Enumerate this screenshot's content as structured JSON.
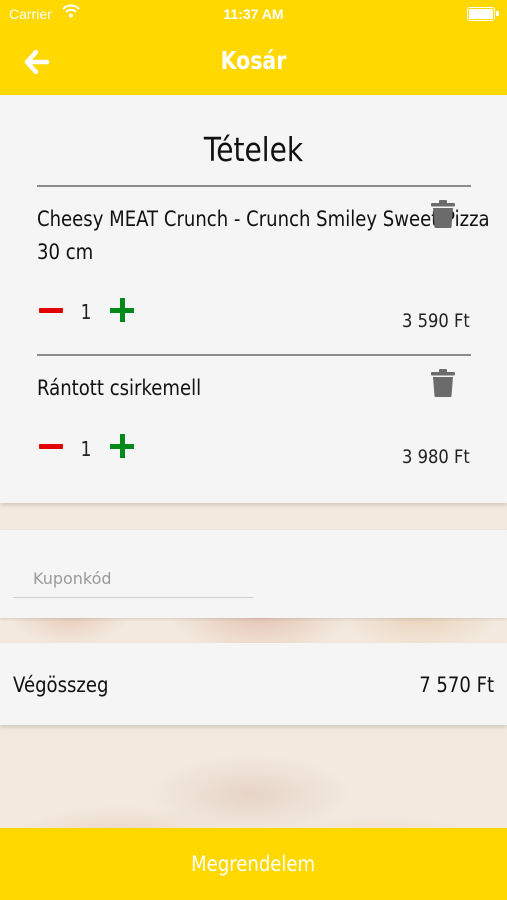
{
  "status_bar": {
    "carrier": "Carrier",
    "time": "11:37 AM"
  },
  "nav": {
    "title": "Kosár",
    "back_icon": "arrow-left-icon"
  },
  "cart": {
    "heading": "Tételek",
    "items": [
      {
        "name_line1": "Cheesy MEAT Crunch - Crunch Smiley Sweet Pizza",
        "name_line2": "30 cm",
        "quantity": "1",
        "price": "3 590 Ft"
      },
      {
        "name_line1": "Rántott csirkemell",
        "quantity": "1",
        "price": "3 980 Ft"
      }
    ]
  },
  "coupon": {
    "placeholder": "Kuponkód"
  },
  "total": {
    "label": "Végösszeg",
    "value": "7 570 Ft"
  },
  "order_button": {
    "label": "Megrendelem"
  },
  "colors": {
    "brand_yellow": "#ffd800",
    "minus_red": "#e10000",
    "plus_green": "#008a1a",
    "trash_gray": "#6b6b6b"
  }
}
